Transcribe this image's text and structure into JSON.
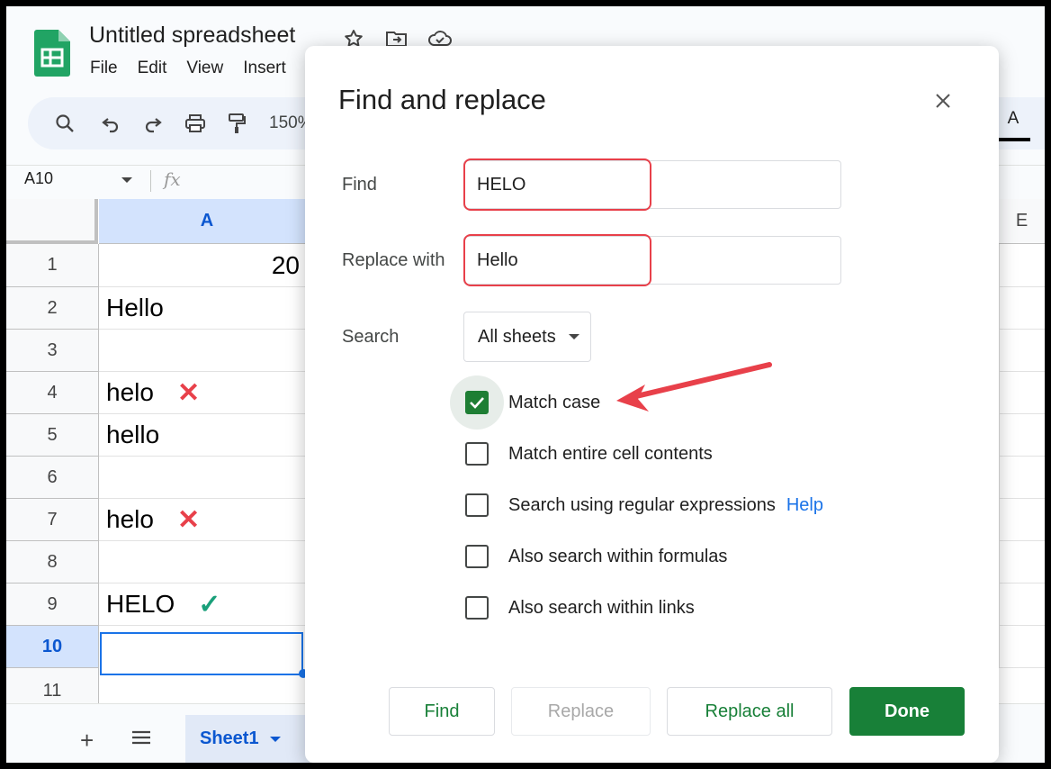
{
  "app": {
    "doc_title": "Untitled spreadsheet",
    "menu": [
      "File",
      "Edit",
      "View",
      "Insert"
    ],
    "zoom": "150%",
    "font_color_label": "A"
  },
  "formula_bar": {
    "name_box": "A10",
    "fx_label": "fx"
  },
  "grid": {
    "columns": [
      "A",
      "E"
    ],
    "rows": [
      {
        "num": "1",
        "value": "20",
        "mark": ""
      },
      {
        "num": "2",
        "value": "Hello",
        "mark": ""
      },
      {
        "num": "3",
        "value": "",
        "mark": ""
      },
      {
        "num": "4",
        "value": "helo",
        "mark": "✕"
      },
      {
        "num": "5",
        "value": "hello",
        "mark": ""
      },
      {
        "num": "6",
        "value": "",
        "mark": ""
      },
      {
        "num": "7",
        "value": "helo",
        "mark": "✕"
      },
      {
        "num": "8",
        "value": "",
        "mark": ""
      },
      {
        "num": "9",
        "value": "HELO",
        "mark": "✓"
      },
      {
        "num": "10",
        "value": "",
        "mark": ""
      },
      {
        "num": "11",
        "value": "",
        "mark": ""
      }
    ]
  },
  "sheets": {
    "add_label": "+",
    "active_tab": "Sheet1"
  },
  "dialog": {
    "title": "Find and replace",
    "find_label": "Find",
    "find_value": "HELO",
    "replace_label": "Replace with",
    "replace_value": "Hello",
    "search_label": "Search",
    "search_scope": "All sheets",
    "options": [
      {
        "label": "Match case",
        "checked": true
      },
      {
        "label": "Match entire cell contents",
        "checked": false
      },
      {
        "label": "Search using regular expressions",
        "checked": false
      },
      {
        "label": "Also search within formulas",
        "checked": false
      },
      {
        "label": "Also search within links",
        "checked": false
      }
    ],
    "help_link": "Help",
    "buttons": {
      "find": "Find",
      "replace": "Replace",
      "replace_all": "Replace all",
      "done": "Done"
    }
  },
  "colors": {
    "accent_green": "#188038",
    "annotation_red": "#e8404a",
    "check_teal": "#1aa07a",
    "selection_blue": "#1a73e8"
  }
}
